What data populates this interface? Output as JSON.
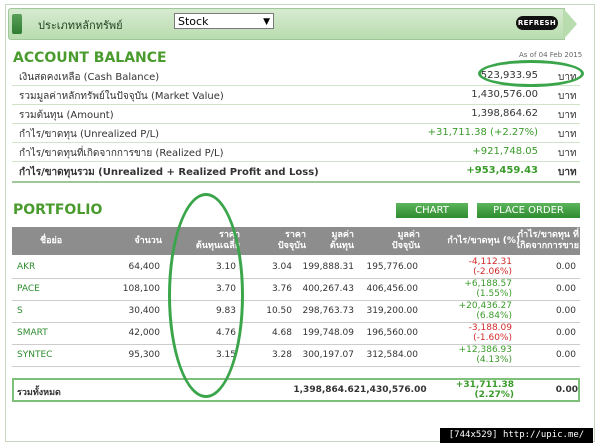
{
  "header": {
    "selector_label": "ประเภทหลักทรัพย์",
    "selected_type": "Stock",
    "refresh_label": "REFRESH"
  },
  "account": {
    "title": "ACCOUNT BALANCE",
    "as_of": "As of 04 Feb 2015",
    "rows": [
      {
        "label": "เงินสดคงเหลือ (Cash Balance)",
        "value": "523,933.95",
        "unit": "บาท"
      },
      {
        "label": "รวมมูลค่าหลักทรัพย์ในปัจจุบัน (Market Value)",
        "value": "1,430,576.00",
        "unit": "บาท"
      },
      {
        "label": "รวมต้นทุน (Amount)",
        "value": "1,398,864.62",
        "unit": "บาท"
      },
      {
        "label": "กำไร/ขาดทุน (Unrealized P/L)",
        "value": "+31,711.38 (+2.27%)",
        "unit": "บาท"
      },
      {
        "label": "กำไร/ขาดทุนที่เกิดจากการขาย (Realized P/L)",
        "value": "+921,748.05",
        "unit": "บาท"
      },
      {
        "label": "กำไร/ขาดทุนรวม (Unrealized + Realized Profit and Loss)",
        "value": "+953,459.43",
        "unit": "บาท"
      }
    ]
  },
  "portfolio": {
    "title": "PORTFOLIO",
    "chart_button": "CHART",
    "place_order_button": "PLACE ORDER",
    "headers": {
      "symbol": "ชื่อย่อ",
      "volume": "จำนวน",
      "avg_cost": [
        "ราคา",
        "ต้นทุนเฉลี่ย"
      ],
      "price": [
        "ราคา",
        "ปัจจุบัน"
      ],
      "cost_value": [
        "มูลค่า",
        "ต้นทุน"
      ],
      "market_value": [
        "มูลค่า",
        "ปัจจุบัน"
      ],
      "unrealized": "กำไร/ขาดทุน (%)",
      "realized": [
        "กำไร/ขาดทุน ที่",
        "เกิดจากการขาย"
      ]
    },
    "rows": [
      {
        "symbol": "AKR",
        "volume": "64,400",
        "avg_cost": "3.10",
        "price": "3.04",
        "cost_value": "199,888.31",
        "market_value": "195,776.00",
        "pl": "-4,112.31",
        "pl_pct": "(-2.06%)",
        "realized": "0.00",
        "pl_color": "#d42a2a"
      },
      {
        "symbol": "PACE",
        "volume": "108,100",
        "avg_cost": "3.70",
        "price": "3.76",
        "cost_value": "400,267.43",
        "market_value": "406,456.00",
        "pl": "+6,188.57",
        "pl_pct": "(1.55%)",
        "realized": "0.00",
        "pl_color": "#3a9b2a"
      },
      {
        "symbol": "S",
        "volume": "30,400",
        "avg_cost": "9.83",
        "price": "10.50",
        "cost_value": "298,763.73",
        "market_value": "319,200.00",
        "pl": "+20,436.27",
        "pl_pct": "(6.84%)",
        "realized": "0.00",
        "pl_color": "#3a9b2a"
      },
      {
        "symbol": "SMART",
        "volume": "42,000",
        "avg_cost": "4.76",
        "price": "4.68",
        "cost_value": "199,748.09",
        "market_value": "196,560.00",
        "pl": "-3,188.09",
        "pl_pct": "(-1.60%)",
        "realized": "0.00",
        "pl_color": "#d42a2a"
      },
      {
        "symbol": "SYNTEC",
        "volume": "95,300",
        "avg_cost": "3.15",
        "price": "3.28",
        "cost_value": "300,197.07",
        "market_value": "312,584.00",
        "pl": "+12,386.93",
        "pl_pct": "(4.13%)",
        "realized": "0.00",
        "pl_color": "#3a9b2a"
      }
    ],
    "total": {
      "label": "รวมทั้งหมด",
      "cost_value": "1,398,864.62",
      "market_value": "1,430,576.00",
      "pl": "+31,711.38",
      "pl_pct": "(2.27%)",
      "realized": "0.00"
    }
  },
  "watermark": "[744x529] http://upic.me/",
  "colors": {
    "accent_green": "#4a9b2d",
    "gain": "#3a9b2a",
    "loss": "#d42a2a",
    "header_gray": "#8d8d8d"
  }
}
